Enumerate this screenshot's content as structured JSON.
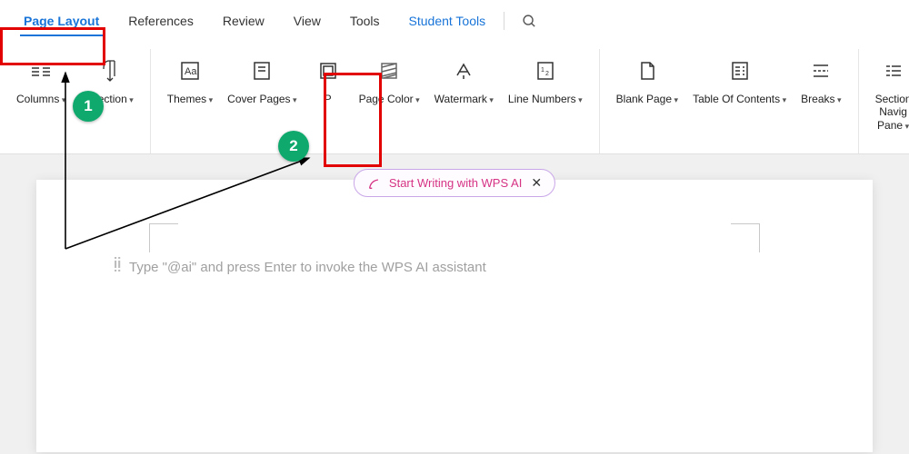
{
  "tabs": {
    "page_layout": "Page Layout",
    "references": "References",
    "review": "Review",
    "view": "View",
    "tools": "Tools",
    "student_tools": "Student Tools"
  },
  "ribbon": {
    "columns": "Columns",
    "direction": "Direction",
    "themes": "Themes",
    "cover_pages": "Cover Pages",
    "page_border": "P",
    "page_color": "Page Color",
    "watermark": "Watermark",
    "line_numbers": "Line Numbers",
    "blank_page": "Blank Page",
    "table_of_contents": "Table Of Contents",
    "breaks": "Breaks",
    "section_nav_pane": "Section Navig Pane"
  },
  "ai": {
    "pill_text": "Start Writing with WPS AI",
    "placeholder": "Type \"@ai\" and press Enter to invoke the WPS AI assistant"
  },
  "markers": {
    "one": "1",
    "two": "2"
  }
}
